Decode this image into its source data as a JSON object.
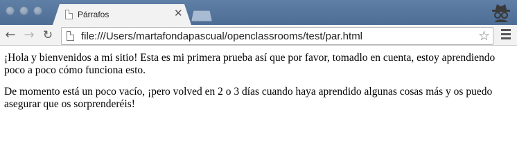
{
  "window": {
    "tab": {
      "title": "Párrafos"
    }
  },
  "toolbar": {
    "url": "file:///Users/martafondapascual/openclassrooms/test/par.html"
  },
  "page": {
    "paragraphs": [
      "¡Hola y bienvenidos a mi sitio! Esta es mi primera prueba así que por favor, tomadlo en cuenta, estoy aprendiendo poco a poco cómo funciona esto.",
      "De momento está un poco vacío, ¡pero volved en 2 o 3 días cuando haya aprendido algunas cosas más y os puedo asegurar que os sorprenderéis!"
    ]
  },
  "icons": {
    "traffic": "window-control-dot",
    "tab_favicon": "document-icon",
    "tab_close": "close-icon",
    "new_tab": "new-tab-icon",
    "profile": "incognito-icon",
    "back": "back-arrow-icon",
    "forward": "forward-arrow-icon",
    "reload": "reload-icon",
    "page": "file-page-icon",
    "bookmark": "star-icon",
    "menu": "hamburger-menu-icon"
  },
  "colors": {
    "titlebar": "#5777a0",
    "toolbar": "#f2f2f2",
    "tab": "#f2f2f2"
  }
}
